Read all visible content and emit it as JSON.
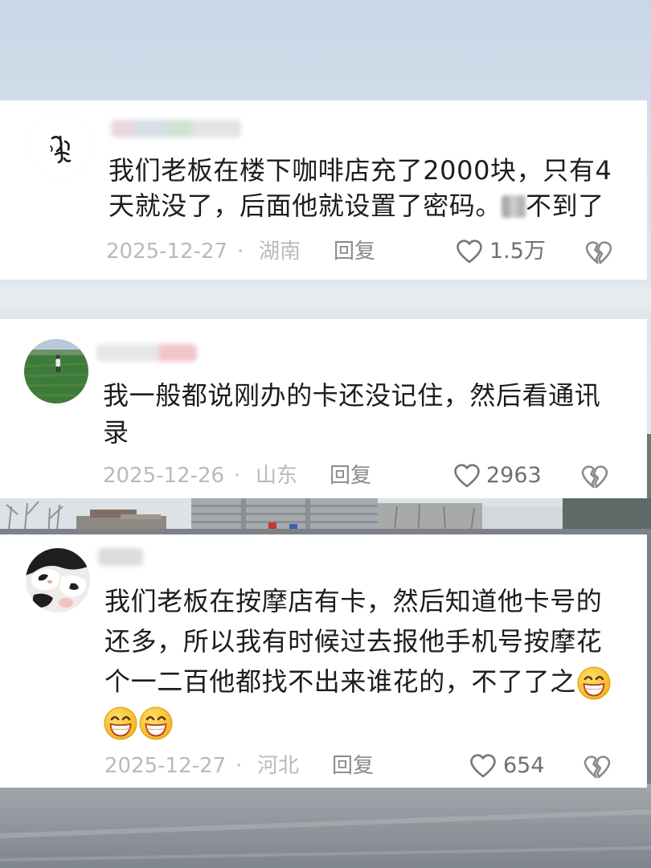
{
  "comments": [
    {
      "avatar_icon": "calligraphy-avatar",
      "text_lines": [
        [
          "我们老板在楼下咖啡店充了2000块，只有4"
        ],
        [
          "天就没了，后面他就设置了密码。",
          "不到了"
        ]
      ],
      "date": "2025-12-27",
      "separator": "·",
      "location": "湖南",
      "reply_label": "回复",
      "likes": "1.5万"
    },
    {
      "avatar_icon": "field-photo-avatar",
      "text_lines": [
        [
          "我一般都说刚办的卡还没记住，然后看通讯"
        ],
        [
          "录"
        ]
      ],
      "date": "2025-12-26",
      "separator": "·",
      "location": "山东",
      "reply_label": "回复",
      "likes": "2963"
    },
    {
      "avatar_icon": "cat-photo-avatar",
      "text_lines": [
        [
          "我们老板在按摩店有卡，然后知道他卡号的"
        ],
        [
          "还多，所以我有时候过去报他手机号按摩花"
        ],
        [
          "个一二百他都找不出来谁花的，不了了之"
        ]
      ],
      "trailing_emoji": [
        "beaming-face-emoji",
        "beaming-face-emoji",
        "beaming-face-emoji"
      ],
      "date": "2025-12-27",
      "separator": "·",
      "location": "河北",
      "reply_label": "回复",
      "likes": "654"
    }
  ],
  "icons": {
    "like": "heart-outline-icon",
    "dislike": "broken-heart-icon",
    "username": "blurred-username",
    "redacted_character": "blurred-character"
  },
  "colors": {
    "card": "#ffffff",
    "comment_text": "#1c1c1c",
    "meta_text": "#bababa",
    "reply_text": "#8a8a8a",
    "like_count": "#707070",
    "emoji": "#ffc72c"
  }
}
